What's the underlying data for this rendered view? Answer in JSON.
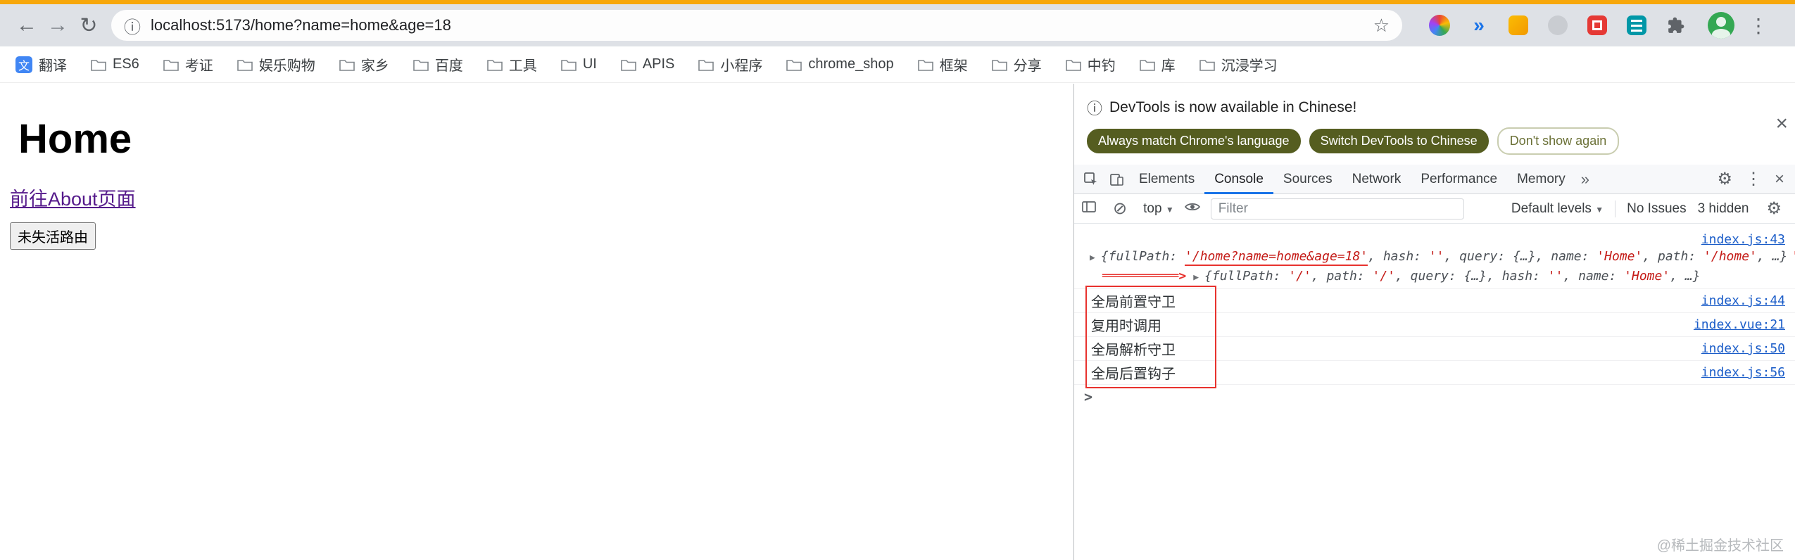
{
  "colors": {
    "top_strip": "#f7a70a",
    "toolbar_bg": "#dee1e6",
    "accent_blue": "#1a73e8",
    "annotation_red": "#e8322e",
    "string_red": "#c41a16",
    "olive_button": "#555d20",
    "visited_link_purple": "#551a8b",
    "devtools_link_blue": "#1a5cc8"
  },
  "icons": {
    "back": "←",
    "forward": "→",
    "refresh": "↻",
    "info": "ⓘ",
    "star": "☆",
    "menu_kebab": "⋮",
    "ext_chevrons": "»",
    "translate_glyph": "文",
    "close": "×",
    "caret_down": "▼",
    "expand_triangle": "▶",
    "clear": "⊘",
    "gear": "⚙",
    "more_tabs": "»",
    "prompt": ">"
  },
  "browser": {
    "url": "localhost:5173/home?name=home&age=18",
    "bookmarks": [
      "翻译",
      "ES6",
      "考证",
      "娱乐购物",
      "家乡",
      "百度",
      "工具",
      "UI",
      "APIS",
      "小程序",
      "chrome_shop",
      "框架",
      "分享",
      "中钓",
      "库",
      "沉浸学习"
    ]
  },
  "page": {
    "heading": "Home",
    "about_link": "前往About页面",
    "keepalive_button": "未失活路由"
  },
  "devtools": {
    "banner": {
      "message": "DevTools is now available in Chinese!",
      "always_match_button": "Always match Chrome's language",
      "switch_button": "Switch DevTools to Chinese",
      "dismiss_button": "Don't show again"
    },
    "tabs": [
      "Elements",
      "Console",
      "Sources",
      "Network",
      "Performance",
      "Memory"
    ],
    "active_tab": "Console",
    "toolbar": {
      "context": "top",
      "filter_placeholder": "Filter",
      "levels_label": "Default levels",
      "issues_label": "No Issues",
      "hidden_label": "3 hidden"
    },
    "console": {
      "log1": {
        "link": "index.js:43",
        "annotation": "'<══════════",
        "seg0": "{fullPath: ",
        "seg1": "'/home?name=home&age=18'",
        "seg2": ", hash: ",
        "seg3": "''",
        "seg4": ", query: ",
        "seg5": "{…}",
        "seg6": ", name: ",
        "seg7": "'Home'",
        "seg8": ", path: ",
        "seg9": "'/home'",
        "seg10": ", …}"
      },
      "log2": {
        "annotation": "══════════>",
        "seg0": "{fullPath: ",
        "seg1": "'/'",
        "seg2": ", path: ",
        "seg3": "'/'",
        "seg4": ", query: ",
        "seg5": "{…}",
        "seg6": ", hash: ",
        "seg7": "''",
        "seg8": ", name: ",
        "seg9": "'Home'",
        "seg10": ", …}"
      },
      "log3": {
        "text": "全局前置守卫",
        "link": "index.js:44"
      },
      "log4": {
        "text": "复用时调用",
        "link": "index.vue:21"
      },
      "log5": {
        "text": "全局解析守卫",
        "link": "index.js:50"
      },
      "log6": {
        "text": "全局后置钩子",
        "link": "index.js:56"
      }
    },
    "watermark": "@稀土掘金技术社区"
  }
}
